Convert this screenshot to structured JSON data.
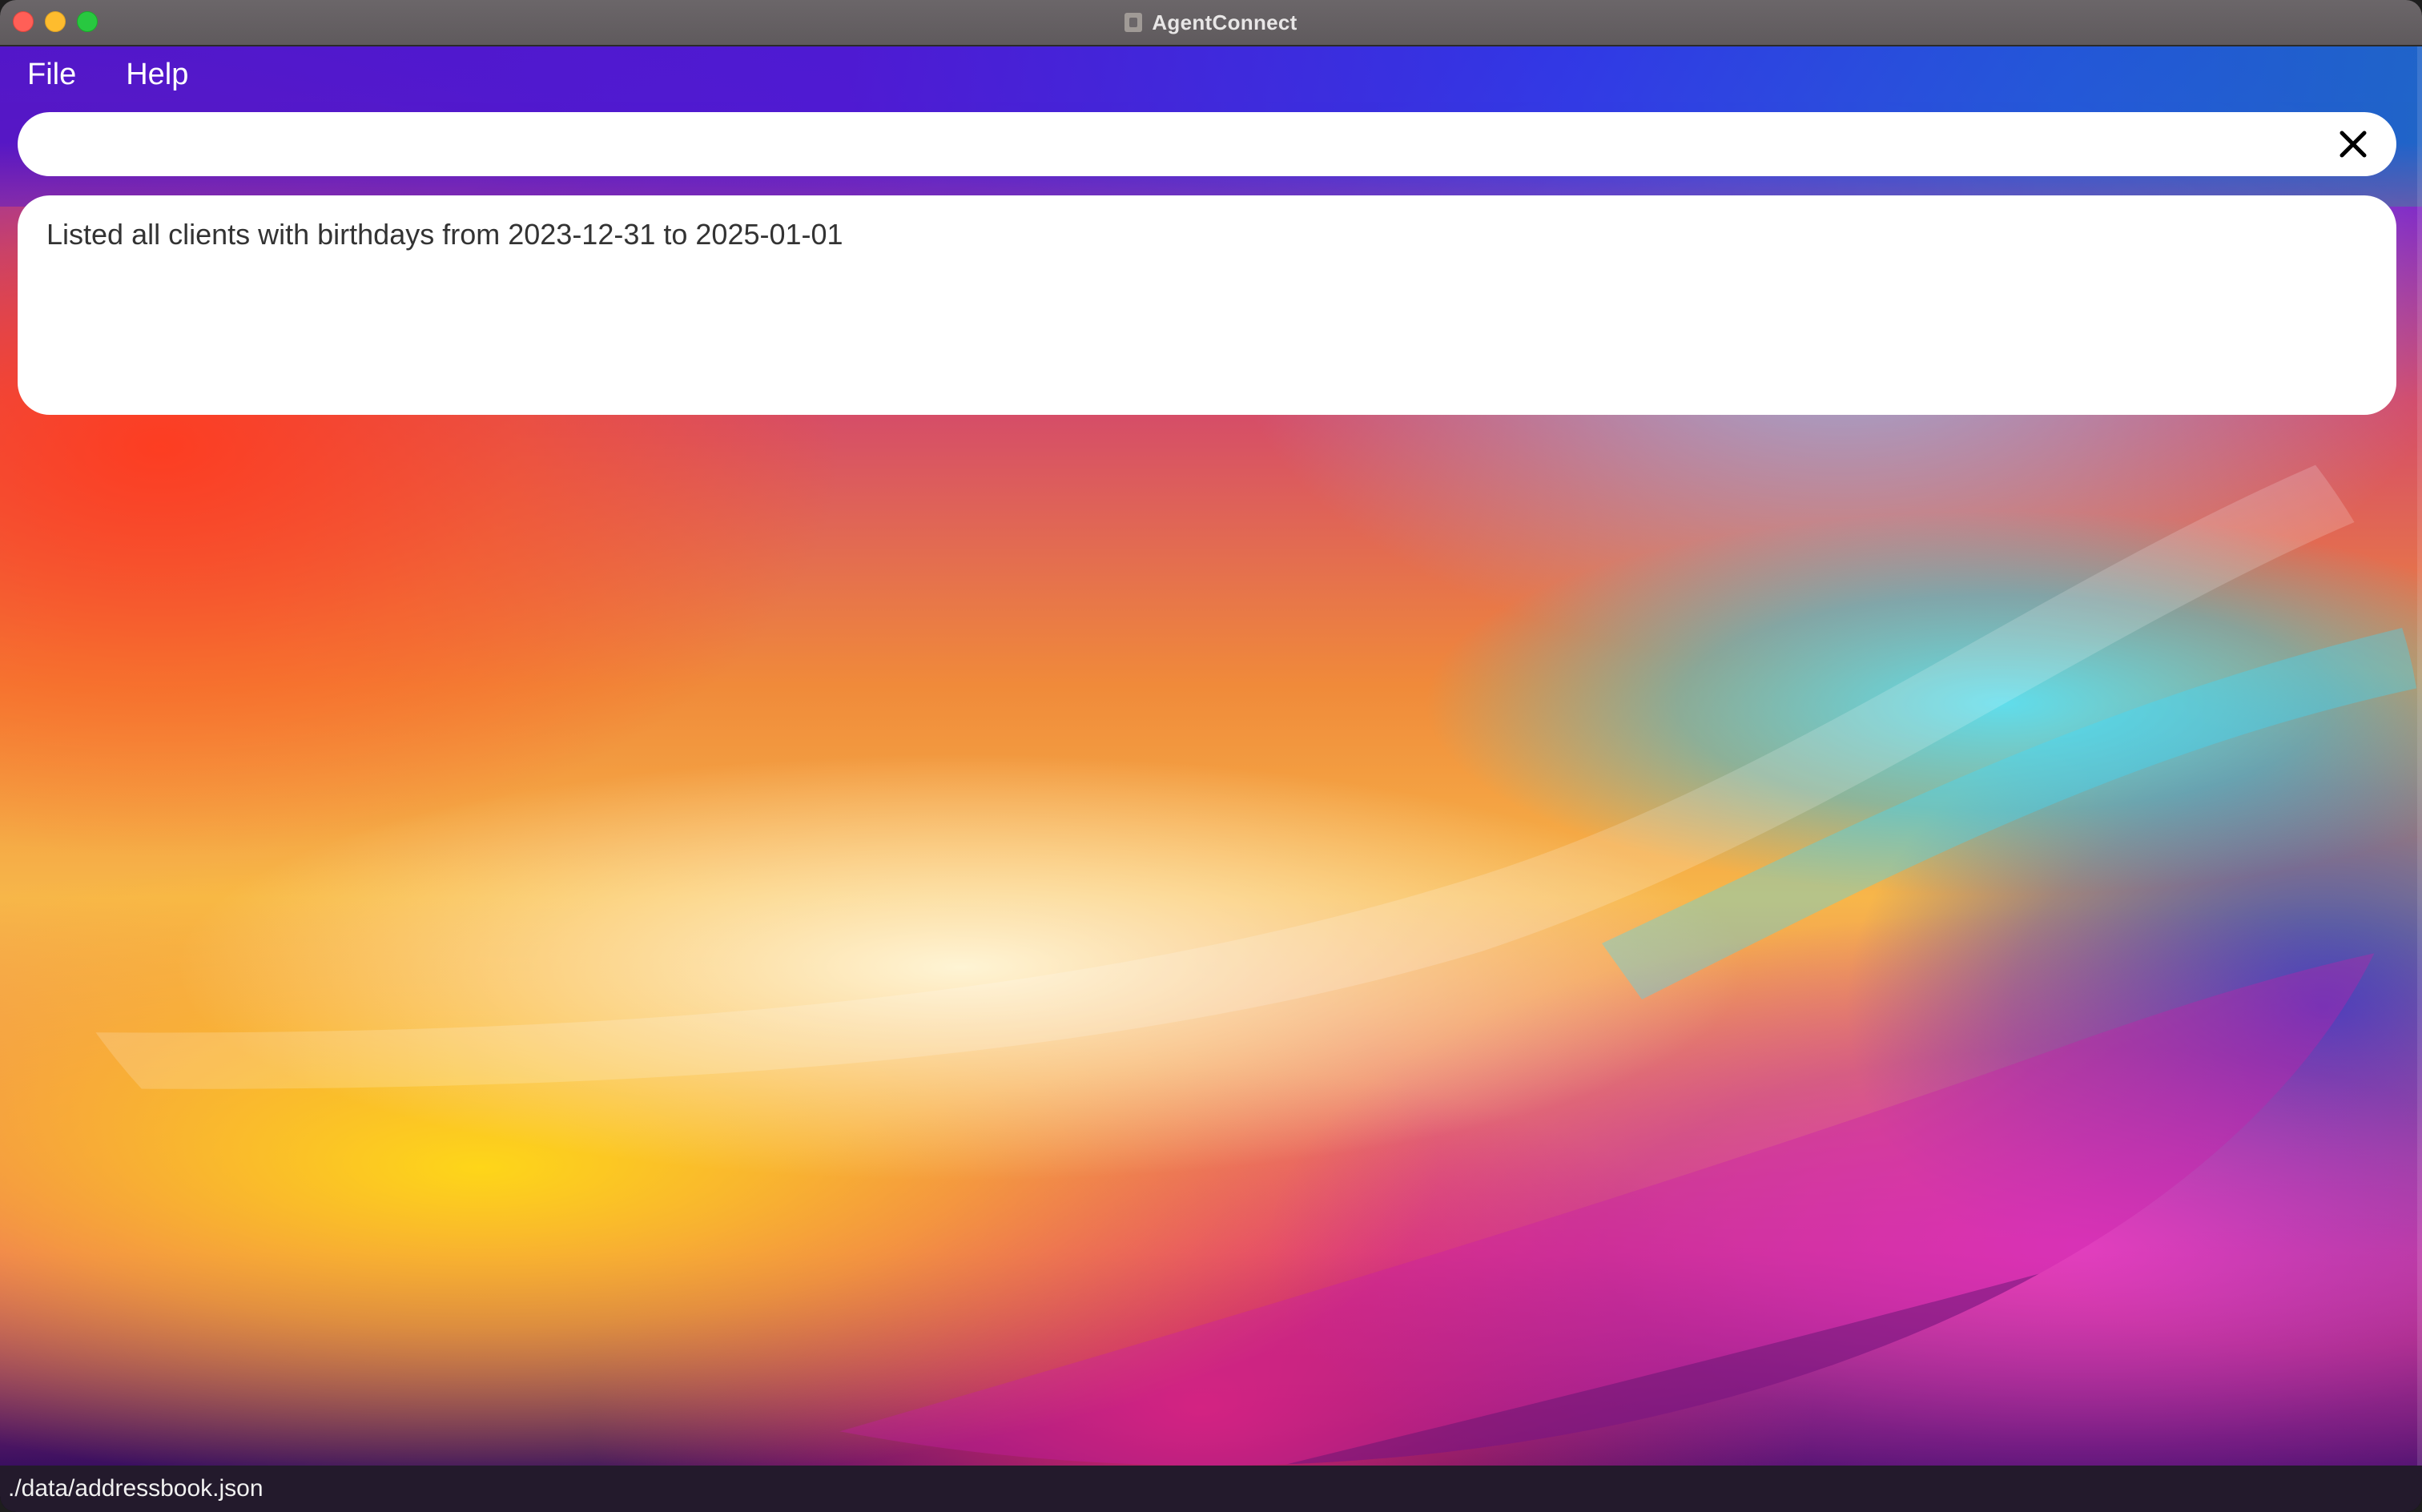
{
  "window": {
    "title": "AgentConnect"
  },
  "menu": {
    "items": [
      "File",
      "Help"
    ]
  },
  "command": {
    "value": "",
    "placeholder": ""
  },
  "result": {
    "message": "Listed all clients with birthdays from 2023-12-31 to 2025-01-01"
  },
  "status": {
    "file_path": "./data/addressbook.json"
  },
  "icons": {
    "clear": "close-icon",
    "app": "contact-card-icon"
  },
  "colors": {
    "close_button": "#ff5f57",
    "minimize_button": "#febc2e",
    "maximize_button": "#28c840",
    "panel_background": "#ffffff",
    "status_bar": "#231a2c"
  }
}
